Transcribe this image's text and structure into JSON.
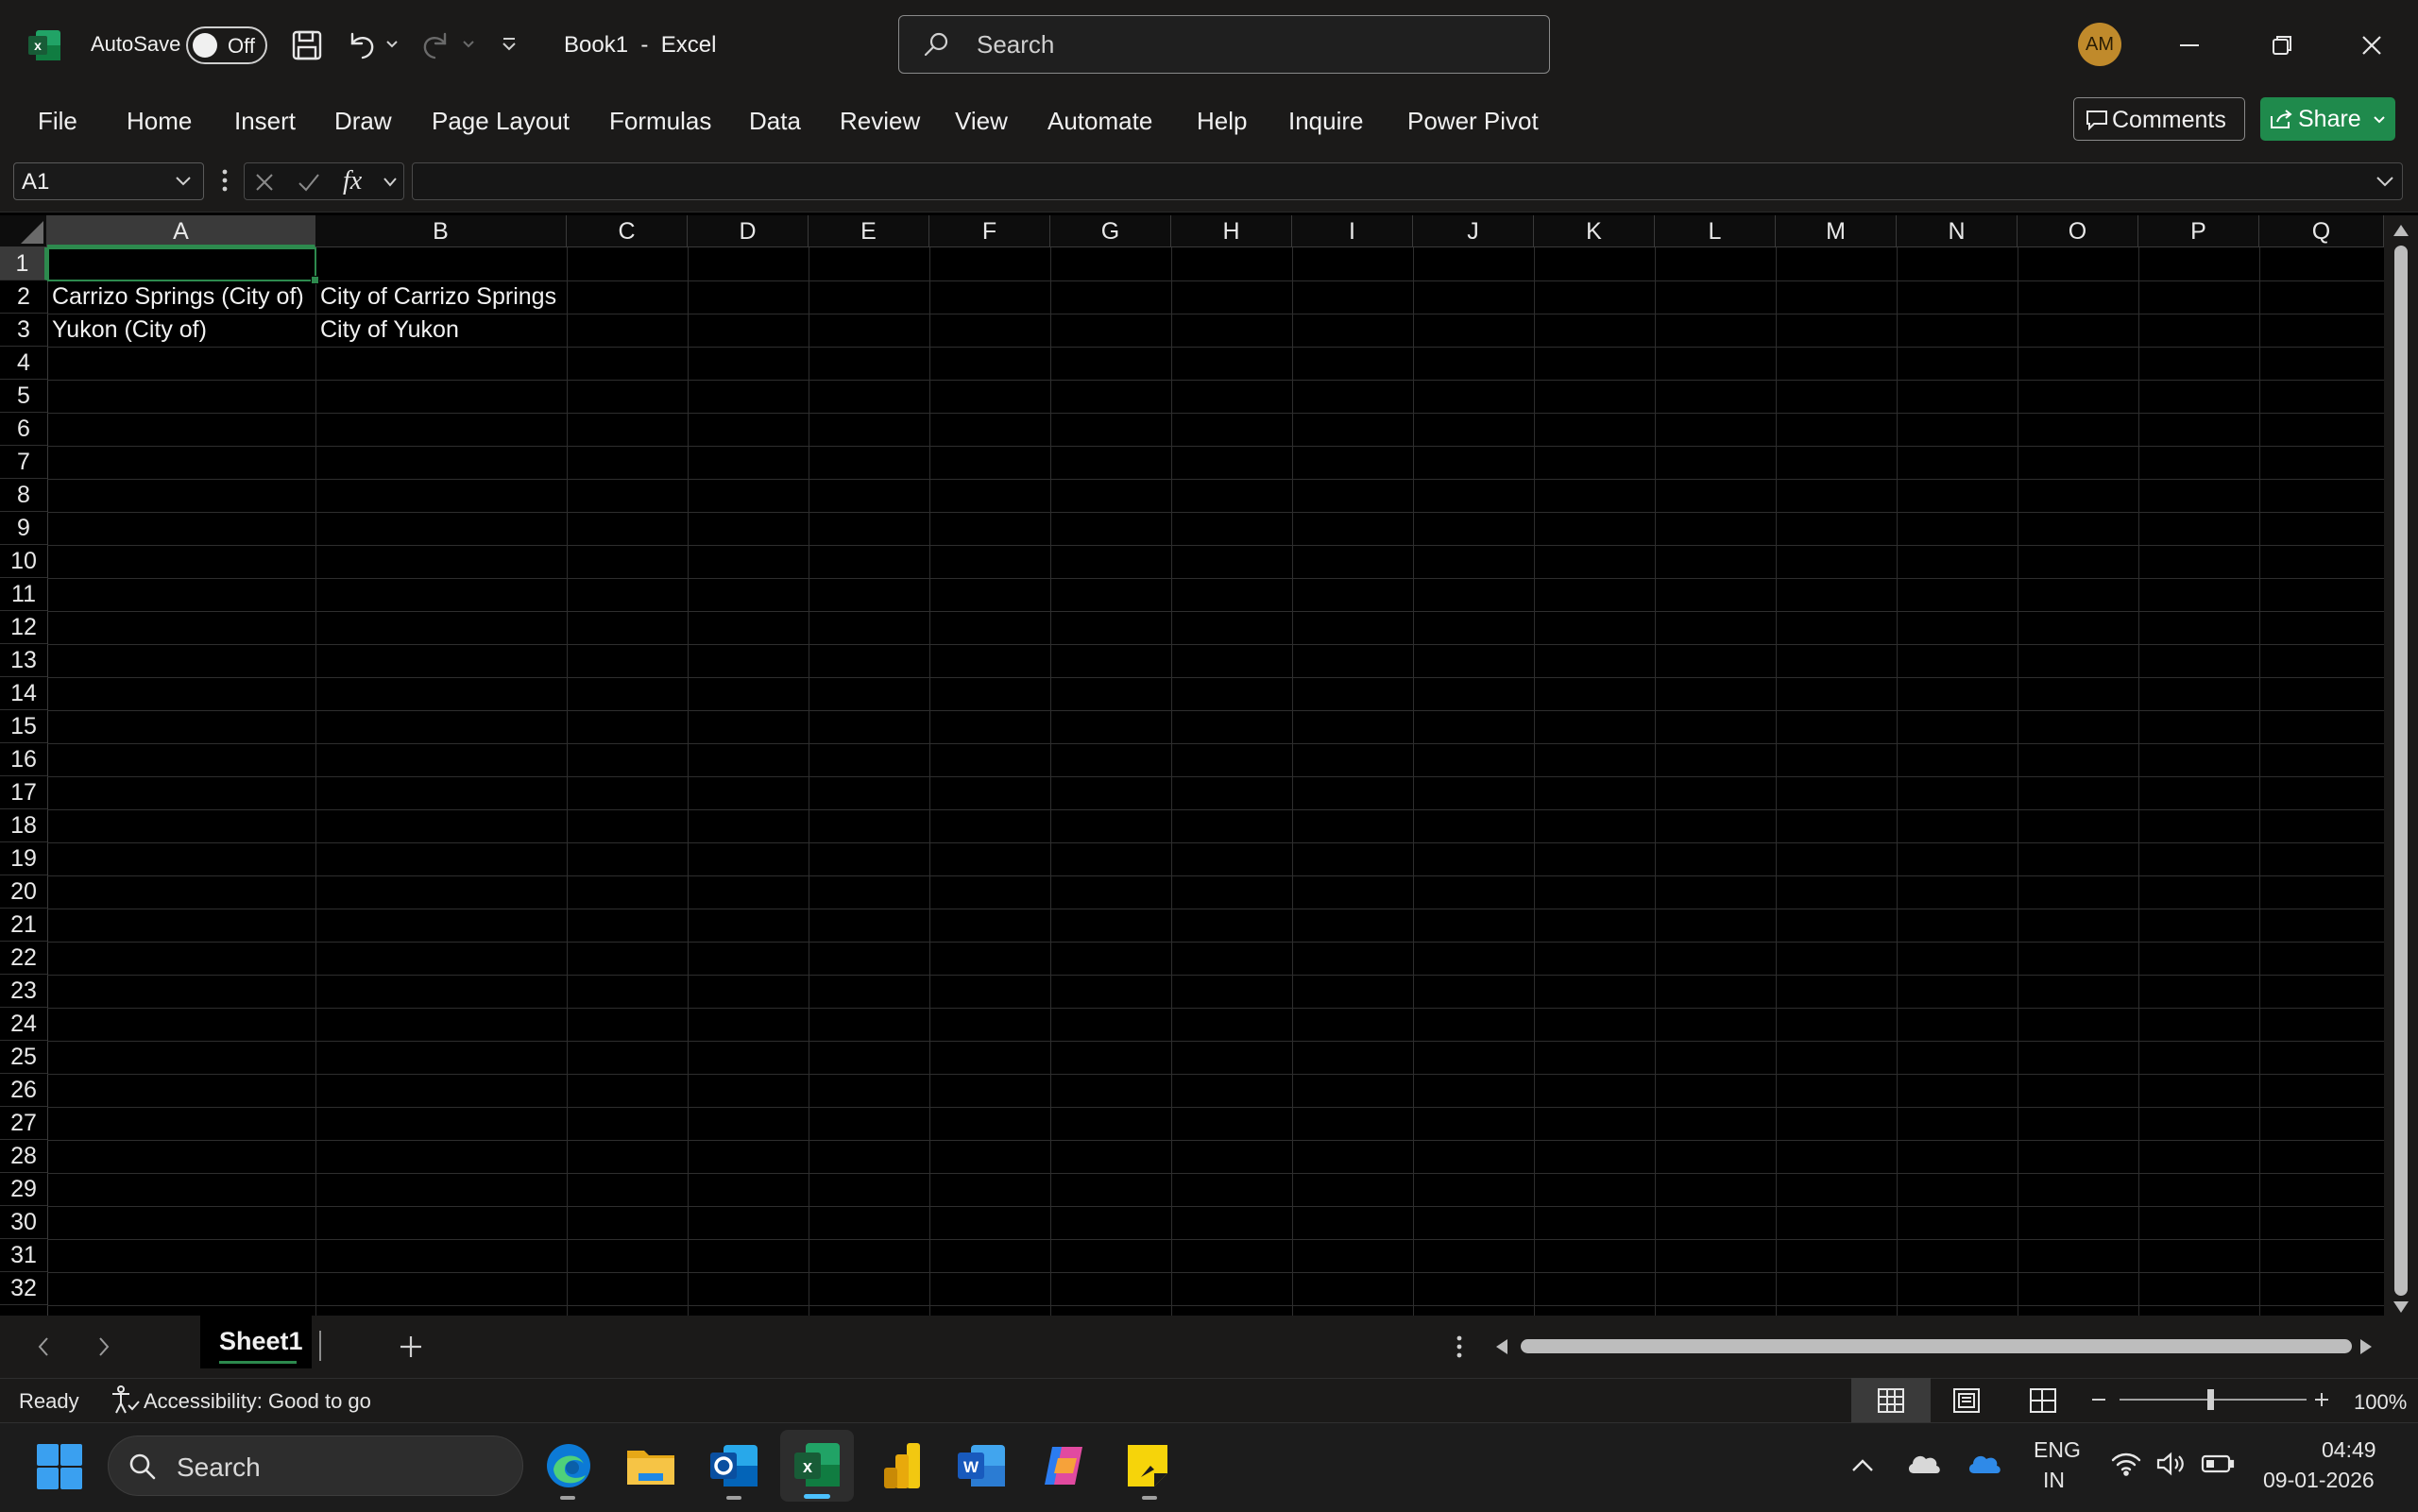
{
  "titlebar": {
    "autosave_label": "AutoSave",
    "autosave_state": "Off",
    "doc_title": "Book1  -  Excel",
    "search_placeholder": "Search",
    "avatar_initials": "AM"
  },
  "ribbon": {
    "tabs": [
      "File",
      "Home",
      "Insert",
      "Draw",
      "Page Layout",
      "Formulas",
      "Data",
      "Review",
      "View",
      "Automate",
      "Help",
      "Inquire",
      "Power Pivot"
    ],
    "comments_label": "Comments",
    "share_label": "Share"
  },
  "formula_bar": {
    "name_box": "A1",
    "fx_label": "fx",
    "content": ""
  },
  "grid": {
    "columns": [
      "A",
      "B",
      "C",
      "D",
      "E",
      "F",
      "G",
      "H",
      "I",
      "J",
      "K",
      "L",
      "M",
      "N",
      "O",
      "P",
      "Q"
    ],
    "rows": [
      "1",
      "2",
      "3",
      "4",
      "5",
      "6",
      "7",
      "8",
      "9",
      "10",
      "11",
      "12",
      "13",
      "14",
      "15",
      "16",
      "17",
      "18",
      "19",
      "20",
      "21",
      "22",
      "23",
      "24",
      "25",
      "26",
      "27",
      "28",
      "29",
      "30",
      "31",
      "32"
    ],
    "cells": {
      "A2": "Carrizo Springs (City of)",
      "B2": "City of Carrizo Springs",
      "A3": "Yukon (City of)",
      "B3": "City of Yukon"
    },
    "selected_cell": "A1"
  },
  "sheets": {
    "tabs": [
      "Sheet1"
    ],
    "active": "Sheet1"
  },
  "status": {
    "ready": "Ready",
    "accessibility": "Accessibility: Good to go",
    "zoom": "100%"
  },
  "taskbar": {
    "search_placeholder": "Search",
    "lang_line1": "ENG",
    "lang_line2": "IN",
    "time": "04:49",
    "date": "09-01-2026"
  },
  "colors": {
    "chrome_bg": "#1b1a19",
    "grid_bg": "#000000",
    "accent_green": "#107c41",
    "share_green": "#1f8a4c",
    "avatar_bg": "#c08a2b"
  }
}
